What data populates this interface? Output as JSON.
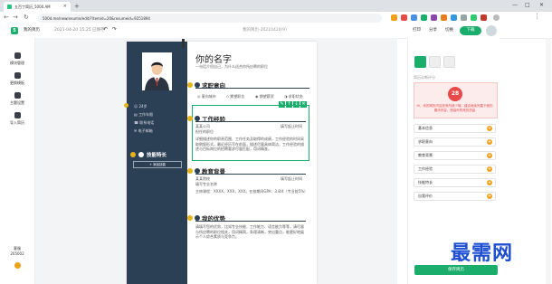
{
  "browser": {
    "tab_title": "五百丁简历_5000.AM",
    "tab_close": "×",
    "new_tab": "+",
    "url": "500d.me/newresume/edit/?itemid=20&resumeid=9251894",
    "controls": [
      "—",
      "□",
      "✕"
    ]
  },
  "app": {
    "logo": "5",
    "my_resume": "我的简历",
    "saved_at": "2021-04-20 15:25 已保存",
    "undo": "↶",
    "redo": "↷",
    "doc_name": "我的简历-20210420(9)",
    "actions": {
      "print": "打印",
      "share": "分享",
      "translate": "切换",
      "download": "下载"
    }
  },
  "leftnav": {
    "items": [
      {
        "label": "模块管理"
      },
      {
        "label": "更换模板"
      },
      {
        "label": "主题设置"
      },
      {
        "label": "导入简历"
      }
    ],
    "bottom": {
      "label": "客服",
      "value": "205002"
    }
  },
  "resume": {
    "name": "你的名字",
    "intro": "一句话介绍自己，为什么适合你所应聘的职位",
    "contacts": [
      "24岁",
      "工作年限",
      "联系电话",
      "电子邮箱"
    ],
    "skills_title": "技能特长",
    "add_skill": "+ 添加技能",
    "job_intent": {
      "title": "求职意向",
      "fields": [
        "意向城市",
        "期望职位",
        "期望薪资",
        "求职状态"
      ]
    },
    "work": {
      "title": "工作经验",
      "company": "某某公司",
      "role": "担任的职位",
      "period": "填写起止时间",
      "desc": "详细描述你的职责范围、工作任务及取得的成绩，工作经验的时间采取倒叙形式，最近经历写在前面，描述尽量具体简洁，工作经验的描述与目标岗位的招聘要求尽量匹配，用词精准。"
    },
    "education": {
      "title": "教育背景",
      "school": "某某院校",
      "major": "填写专业名称",
      "period": "填写起止时间",
      "desc": "主修课程：XXXX，XXX，XXX。在校期间GPA：3.8/4（专业前5%）"
    },
    "advantages": {
      "title": "我的优势",
      "desc": "请填写您的优势，比如专业技能、工作能力、语言能力等等，请尽量与所应聘的职位相关，用词精简，条理清晰，突出重点，能更好地展示个人综合素质与竞争力。"
    },
    "toolbar_icons": [
      "✎",
      "↑",
      "↓",
      "✕"
    ]
  },
  "panel": {
    "tabs": [
      "settings",
      "module",
      "layout"
    ],
    "diagnosis_label": "简历诊断评分",
    "score": "28",
    "score_tip": "Hi，你的简历内容还有所缺少哦，建议继续完善下面的模块内容，提高你的简历质量",
    "items": [
      "基本信息",
      "求职意向",
      "教育背景",
      "工作经验",
      "技能特长",
      "自我评价"
    ],
    "plus": "+",
    "save": "保存简历"
  },
  "watermark": "最需网"
}
